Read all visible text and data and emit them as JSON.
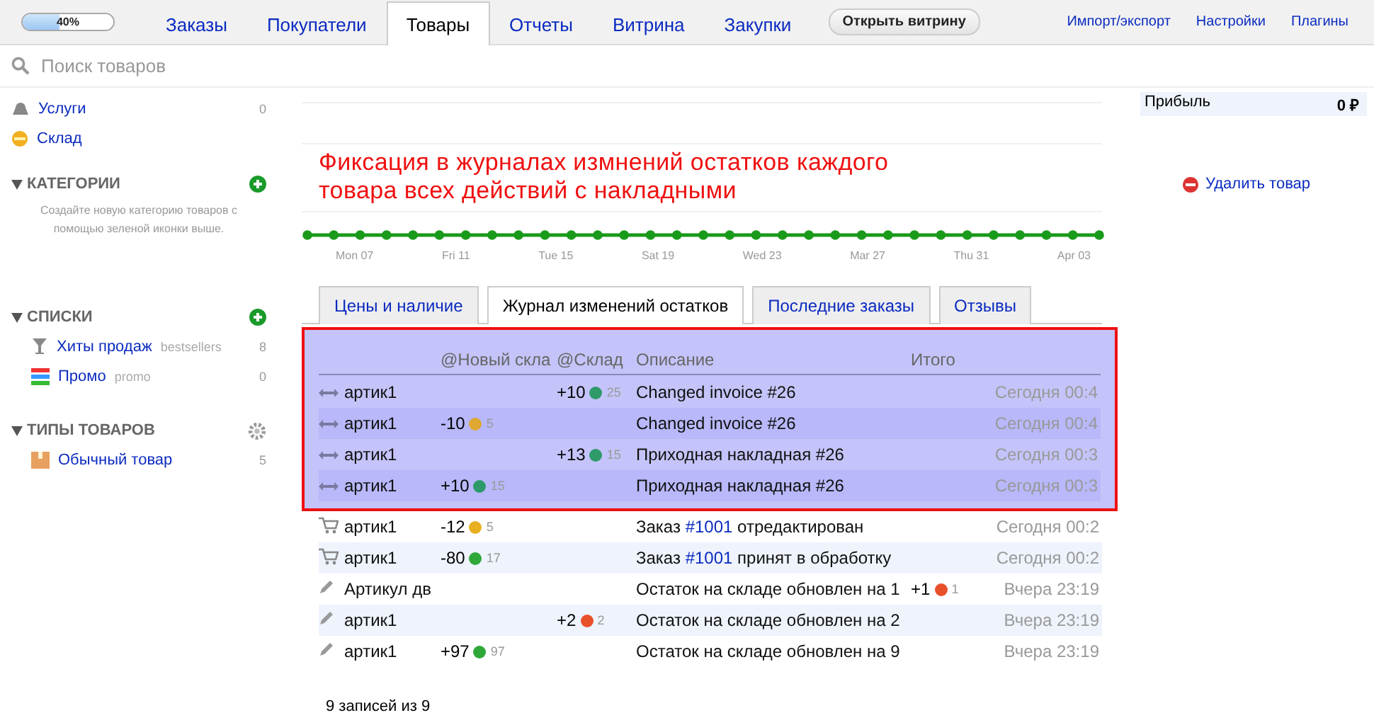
{
  "header": {
    "progress": {
      "label": "40%",
      "level": 0.4
    },
    "tabs": [
      {
        "label": "Заказы",
        "selected": false
      },
      {
        "label": "Покупатели",
        "selected": false
      },
      {
        "label": "Товары",
        "selected": true
      },
      {
        "label": "Отчеты",
        "selected": false
      },
      {
        "label": "Витрина",
        "selected": false
      },
      {
        "label": "Закупки",
        "selected": false
      }
    ],
    "open_button": "Открыть витрину",
    "links": [
      "Импорт/экспорт",
      "Настройки",
      "Плагины"
    ]
  },
  "search": {
    "placeholder": "Поиск товаров"
  },
  "sidebar": {
    "top_items": [
      {
        "kind": "services",
        "label": "Услуги",
        "count": "0"
      },
      {
        "kind": "stock",
        "label": "Склад"
      }
    ],
    "sections": [
      {
        "kind": "categories",
        "title": "КАТЕГОРИИ",
        "hint": "Создайте новую категорию товаров с помощью зеленой иконки выше."
      },
      {
        "kind": "lists",
        "title": "СПИСКИ",
        "items": [
          {
            "kind": "hits",
            "label": "Хиты продаж",
            "slug": "bestsellers",
            "count": "8"
          },
          {
            "kind": "promo",
            "label": "Промо",
            "slug": "promo",
            "count": "0"
          }
        ]
      },
      {
        "kind": "types",
        "title": "ТИПЫ ТОВАРОВ",
        "items": [
          {
            "kind": "box",
            "label": "Обычный товар",
            "count": "5"
          }
        ]
      }
    ]
  },
  "annotation": "Фиксация в журналах измнений остатков каждого товара всех действий с накладными",
  "timeline": {
    "labels": [
      "Mon 07",
      "Fri 11",
      "Tue 15",
      "Sat 19",
      "Wed 23",
      "Mar 27",
      "Thu 31",
      "Apr 03"
    ]
  },
  "product_tabs": [
    {
      "label": "Цены и наличие",
      "selected": false
    },
    {
      "label": "Журнал изменений остатков",
      "selected": true
    },
    {
      "label": "Последние заказы",
      "selected": false
    },
    {
      "label": "Отзывы",
      "selected": false
    }
  ],
  "table": {
    "columns": [
      "@Новый скла",
      "@Склад",
      "Описание",
      "Итого"
    ],
    "rows": [
      {
        "kind": "transfer",
        "highlighted": true,
        "sku": "артик1",
        "new_stock": null,
        "stock": {
          "delta": "+10",
          "qty": "25",
          "color": "#2e9a6a"
        },
        "description": [
          "Changed invoice #26"
        ],
        "total": null,
        "time": "Сегодня 00:4"
      },
      {
        "kind": "transfer",
        "highlighted": true,
        "sku": "артик1",
        "new_stock": {
          "delta": "-10",
          "qty": "5",
          "color": "#e0a830"
        },
        "stock": null,
        "description": [
          "Changed invoice #26"
        ],
        "total": null,
        "time": "Сегодня 00:4"
      },
      {
        "kind": "transfer",
        "highlighted": true,
        "sku": "артик1",
        "new_stock": null,
        "stock": {
          "delta": "+13",
          "qty": "15",
          "color": "#2e9a6a"
        },
        "description": [
          "Приходная накладная #26"
        ],
        "total": null,
        "time": "Сегодня 00:3"
      },
      {
        "kind": "transfer",
        "highlighted": true,
        "sku": "артик1",
        "new_stock": {
          "delta": "+10",
          "qty": "15",
          "color": "#2e9a6a"
        },
        "stock": null,
        "description": [
          "Приходная накладная #26"
        ],
        "total": null,
        "time": "Сегодня 00:3"
      },
      {
        "kind": "order",
        "highlighted": false,
        "sku": "артик1",
        "new_stock": {
          "delta": "-12",
          "qty": "5",
          "color": "#e8b020"
        },
        "stock": null,
        "description": [
          "Заказ",
          "#1001",
          "отредактирован"
        ],
        "total": null,
        "time": "Сегодня 00:2"
      },
      {
        "kind": "order",
        "highlighted": false,
        "sku": "артик1",
        "new_stock": {
          "delta": "-80",
          "qty": "17",
          "color": "#2fa83a"
        },
        "stock": null,
        "description": [
          "Заказ",
          "#1001",
          "принят в обработку"
        ],
        "total": null,
        "time": "Сегодня 00:2"
      },
      {
        "kind": "edit",
        "highlighted": false,
        "sku": "Артикул дв",
        "new_stock": null,
        "stock": null,
        "description": [
          "Остаток на складе обновлен на 1"
        ],
        "total": {
          "delta": "+1",
          "qty": "1",
          "color": "#e8502a"
        },
        "time": "Вчера 23:19"
      },
      {
        "kind": "edit",
        "highlighted": false,
        "sku": "артик1",
        "new_stock": null,
        "stock": {
          "delta": "+2",
          "qty": "2",
          "color": "#e8502a"
        },
        "description": [
          "Остаток на складе обновлен на 2"
        ],
        "total": null,
        "time": "Вчера 23:19"
      },
      {
        "kind": "edit",
        "highlighted": false,
        "sku": "артик1",
        "new_stock": {
          "delta": "+97",
          "qty": "97",
          "color": "#2fa83a"
        },
        "stock": null,
        "description": [
          "Остаток на складе обновлен на 9"
        ],
        "total": null,
        "time": "Вчера 23:19"
      }
    ]
  },
  "footer": "9 записей из 9",
  "profit": {
    "label": "Прибыль",
    "value": "0 ₽"
  },
  "delete_link": "Удалить товар"
}
